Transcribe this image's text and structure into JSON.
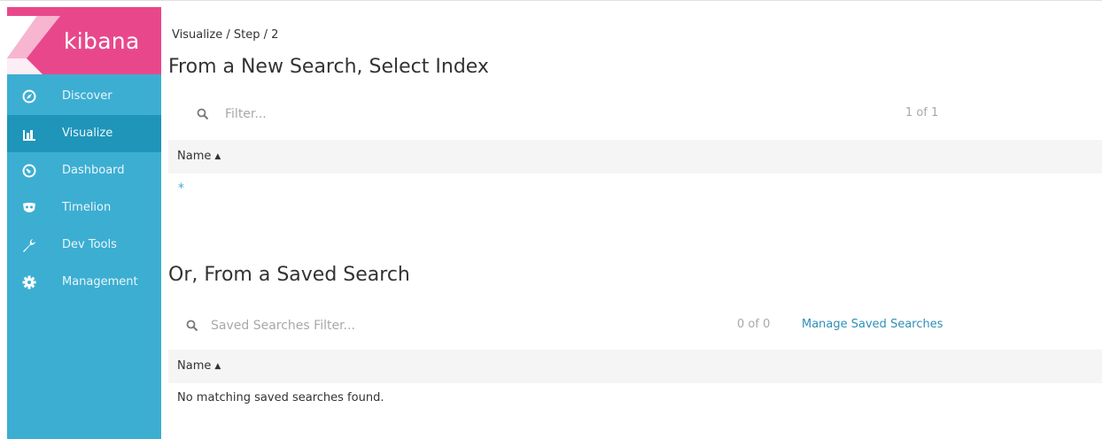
{
  "brand": {
    "name": "kibana",
    "color": "#e8488b",
    "sidebar_color": "#3caed2",
    "active_color": "#1f95ba"
  },
  "nav": {
    "items": [
      {
        "label": "Discover",
        "icon": "compass-icon",
        "active": false
      },
      {
        "label": "Visualize",
        "icon": "bar-chart-icon",
        "active": true
      },
      {
        "label": "Dashboard",
        "icon": "gauge-icon",
        "active": false
      },
      {
        "label": "Timelion",
        "icon": "mask-icon",
        "active": false
      },
      {
        "label": "Dev Tools",
        "icon": "wrench-icon",
        "active": false
      },
      {
        "label": "Management",
        "icon": "gear-icon",
        "active": false
      }
    ]
  },
  "breadcrumb": "Visualize / Step / 2",
  "new_search": {
    "title": "From a New Search, Select Index",
    "filter_placeholder": "Filter...",
    "count": "1 of 1",
    "column": "Name",
    "rows": [
      "*"
    ]
  },
  "saved_search": {
    "title": "Or, From a Saved Search",
    "filter_placeholder": "Saved Searches Filter...",
    "count": "0 of 0",
    "manage_link": "Manage Saved Searches",
    "column": "Name",
    "empty_message": "No matching saved searches found."
  }
}
